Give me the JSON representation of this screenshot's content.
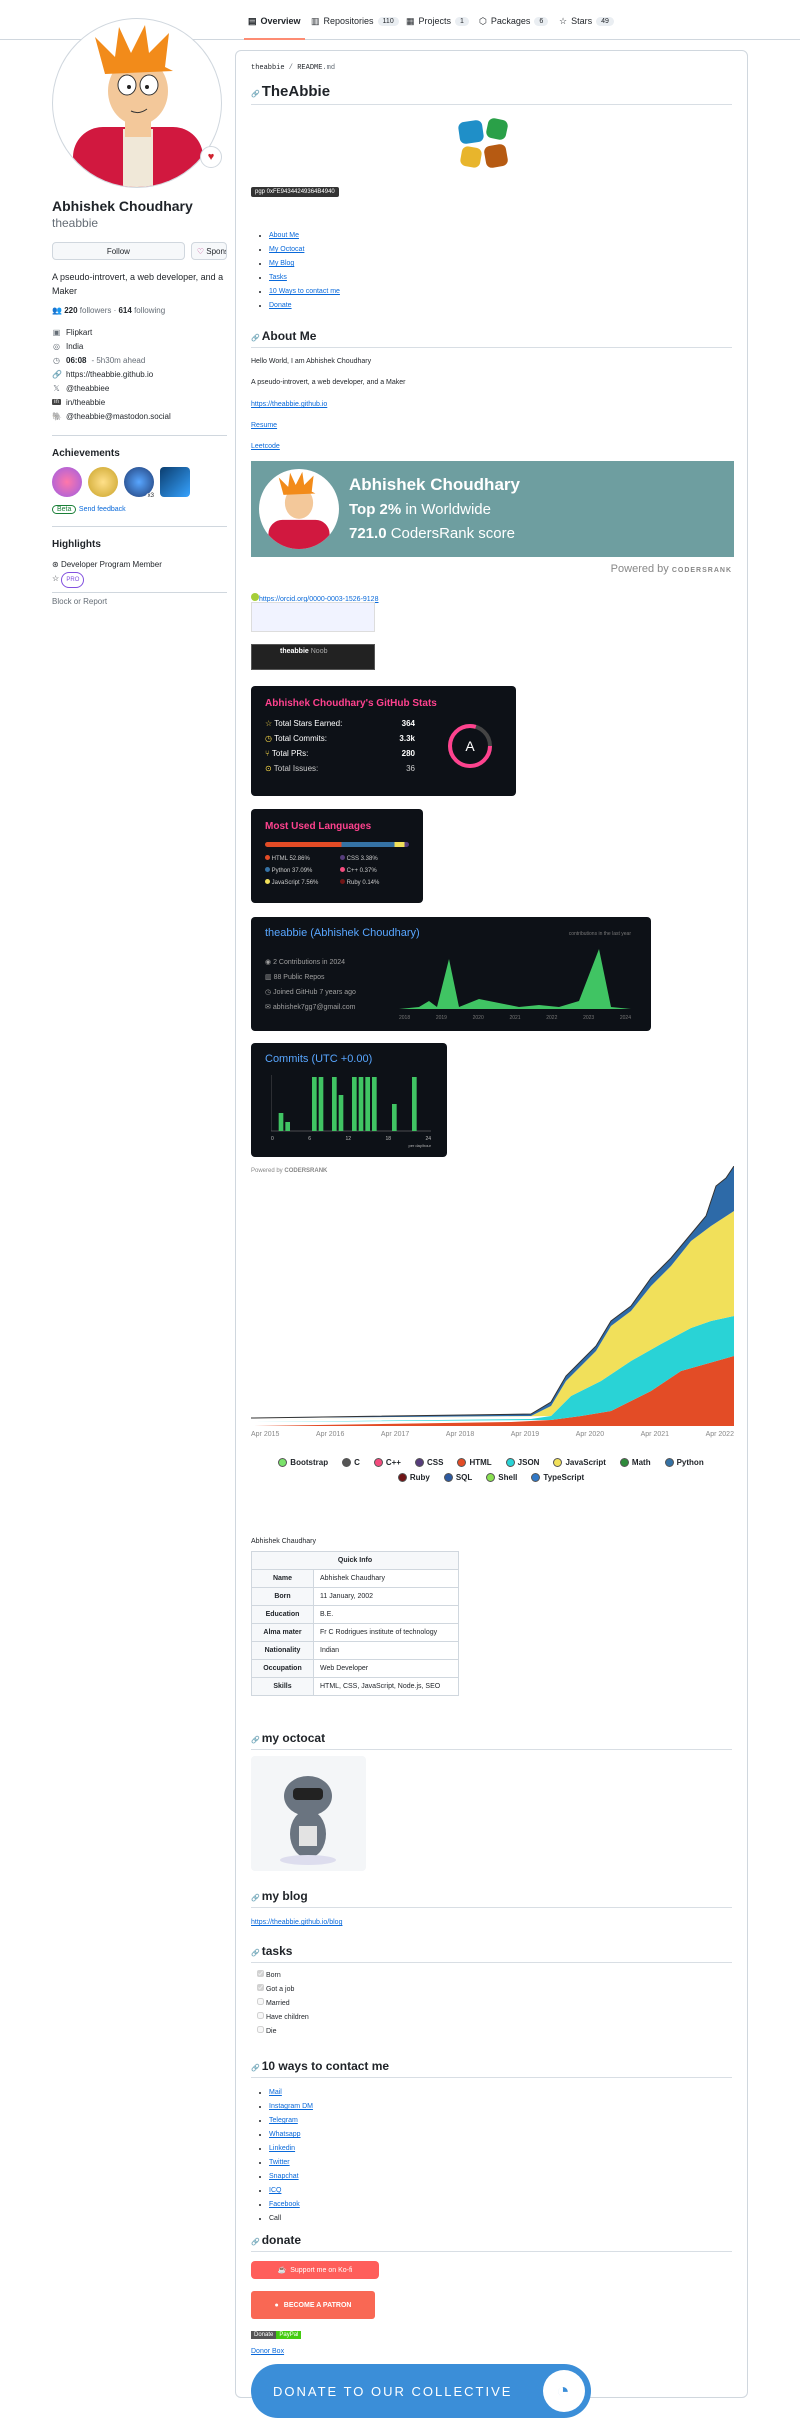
{
  "tabs": [
    {
      "label": "Overview",
      "count": ""
    },
    {
      "label": "Repositories",
      "count": "110"
    },
    {
      "label": "Projects",
      "count": "1"
    },
    {
      "label": "Packages",
      "count": "6"
    },
    {
      "label": "Stars",
      "count": "49"
    }
  ],
  "profile": {
    "name": "Abhishek Choudhary",
    "login": "theabbie",
    "follow_label": "Follow",
    "sponsor_label": "Sponsor",
    "bio": "A pseudo-introvert, a web developer, and a Maker",
    "followers": "220",
    "followers_label": "followers",
    "following": "614",
    "following_label": "following",
    "company": "Flipkart",
    "location": "India",
    "time": "06:08",
    "time_note": "- 5h30m ahead",
    "website": "https://theabbie.github.io",
    "twitter": "@theabbiee",
    "linkedin": "in/theabbie",
    "mastodon": "@theabbie@mastodon.social",
    "achievements_title": "Achievements",
    "ach_badge": "x3",
    "beta_label": "Beta",
    "feedback_label": "Send feedback",
    "highlights_title": "Highlights",
    "highlight_1": "Developer Program Member",
    "pro_label": "PRO",
    "block_label": "Block or Report"
  },
  "readme": {
    "crumb_user": "theabbie",
    "crumb_file": "README",
    "crumb_ext": ".md",
    "title": "TheAbbie",
    "pgp": "pgp 0xFE94344249364B4940",
    "toc": [
      "About Me",
      "My Octocat",
      "My Blog",
      "Tasks",
      "10 Ways to contact me",
      "Donate"
    ],
    "about_title": "About Me",
    "about_hello": "Hello World, I am Abhishek Choudhary",
    "about_bio": "A pseudo-introvert, a web developer, and a Maker",
    "about_link": "https://theabbie.github.io",
    "resume": "Resume",
    "leetcode": "Leetcode",
    "cr_name": "Abhishek Choudhary",
    "cr_top_pct": "Top 2%",
    "cr_top_rest": " in Worldwide",
    "cr_score": "721.0",
    "cr_score_rest": " CodersRank score",
    "powered_by": "Powered by",
    "codersrank": "CODERSRANK",
    "orcid": "https://orcid.org/0000-0003-1526-9128",
    "badge_name": "theabbie",
    "badge_sub": "Noob",
    "stats_title": "Abhishek Choudhary's GitHub Stats",
    "stats": [
      {
        "label": "Total Stars Earned:",
        "value": "364"
      },
      {
        "label": "Total Commits:",
        "value": "3.3k"
      },
      {
        "label": "Total PRs:",
        "value": "280"
      },
      {
        "label": "Total Issues:",
        "value": "36"
      }
    ],
    "grade": "A",
    "langs_title": "Most Used Languages",
    "langs": [
      {
        "name": "HTML 52.86%",
        "color": "#e34c26"
      },
      {
        "name": "CSS 3.38%",
        "color": "#563d7c"
      },
      {
        "name": "Python 37.09%",
        "color": "#3572A5"
      },
      {
        "name": "C++ 0.37%",
        "color": "#f34b7d"
      },
      {
        "name": "JavaScript 7.56%",
        "color": "#f1e05a"
      },
      {
        "name": "Ruby 0.14%",
        "color": "#701516"
      }
    ],
    "profile_card_title": "theabbie (Abhishek Choudhary)",
    "profile_card_lines": [
      "2 Contributions in 2024",
      "88 Public Repos",
      "Joined GitHub 7 years ago",
      "abhishek7gg7@gmail.com"
    ],
    "contrib_label": "contributions in the last year",
    "years": [
      "2018",
      "2019",
      "2020",
      "2021",
      "2022",
      "2023",
      "2024"
    ],
    "commits_title": "Commits (UTC +0.00)",
    "commits_axis": [
      "0",
      "6",
      "12",
      "18",
      "24"
    ],
    "commits_unit": "per day/hour",
    "commits_values": [
      0,
      2,
      1,
      0,
      0,
      0,
      6,
      6,
      0,
      6,
      4,
      0,
      6,
      6,
      6,
      6,
      0,
      0,
      3,
      0,
      0,
      6,
      0,
      0
    ],
    "area_x": [
      "Apr 2015",
      "Apr 2016",
      "Apr 2017",
      "Apr 2018",
      "Apr 2019",
      "Apr 2020",
      "Apr 2021",
      "Apr 2022"
    ],
    "area_legend": [
      {
        "name": "Bootstrap",
        "color": "#7ae36b"
      },
      {
        "name": "C",
        "color": "#555555"
      },
      {
        "name": "C++",
        "color": "#f34b7d"
      },
      {
        "name": "CSS",
        "color": "#563d7c"
      },
      {
        "name": "HTML",
        "color": "#e34c26"
      },
      {
        "name": "JSON",
        "color": "#29d3d6"
      },
      {
        "name": "JavaScript",
        "color": "#f1e05a"
      },
      {
        "name": "Math",
        "color": "#2f8a3b"
      },
      {
        "name": "Python",
        "color": "#3572A5"
      },
      {
        "name": "Ruby",
        "color": "#701516"
      },
      {
        "name": "SQL",
        "color": "#2d5aa0"
      },
      {
        "name": "Shell",
        "color": "#89e051"
      },
      {
        "name": "TypeScript",
        "color": "#3178c6"
      }
    ],
    "qi_caption": "Abhishek Chaudhary",
    "qi_title": "Quick Info",
    "qi_rows": [
      {
        "k": "Name",
        "v": "Abhishek Chaudhary"
      },
      {
        "k": "Born",
        "v": "11 January, 2002"
      },
      {
        "k": "Education",
        "v": "B.E."
      },
      {
        "k": "Alma mater",
        "v": "Fr C Rodrigues institute of technology"
      },
      {
        "k": "Nationality",
        "v": "Indian"
      },
      {
        "k": "Occupation",
        "v": "Web Developer"
      },
      {
        "k": "Skills",
        "v": "HTML, CSS, JavaScript, Node.js, SEO"
      }
    ],
    "octocat_title": "my octocat",
    "blog_title": "my blog",
    "blog_link": "https://theabbie.github.io/blog",
    "tasks_title": "tasks",
    "tasks": [
      {
        "label": "Born",
        "done": true
      },
      {
        "label": "Got a job",
        "done": true
      },
      {
        "label": "Married",
        "done": false
      },
      {
        "label": "Have children",
        "done": false
      },
      {
        "label": "Die",
        "done": false
      }
    ],
    "contact_title": "10 ways to contact me",
    "contacts": [
      "Mail",
      "Instagram DM",
      "Telegram",
      "Whatsapp",
      "Linkedin",
      "Twitter",
      "Snapchat",
      "ICQ",
      "Facebook",
      "Call"
    ],
    "donate_title": "donate",
    "kofi": "Support me on Ko-fi",
    "patron": "BECOME A PATRON",
    "donate_badge_l": "Donate",
    "donate_badge_r": "PayPal",
    "donorbox": "Donor Box",
    "collective": "DONATE TO OUR COLLECTIVE"
  }
}
